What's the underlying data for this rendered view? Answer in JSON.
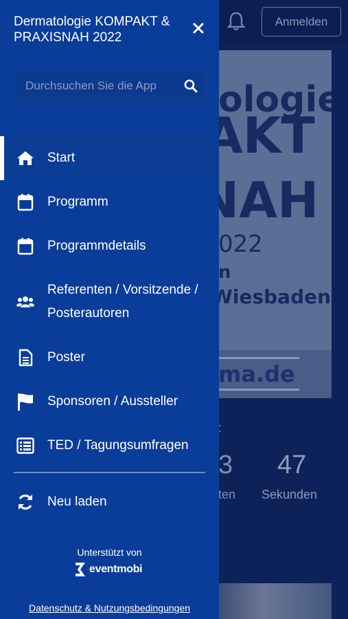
{
  "drawer": {
    "title": "Dermatologie KOMPAKT & PRAXISNAH 2022",
    "search_placeholder": "Durchsuchen Sie die App",
    "items": [
      {
        "label": "Start",
        "icon": "home-icon",
        "active": true
      },
      {
        "label": "Programm",
        "icon": "calendar-icon"
      },
      {
        "label": "Programmdetails",
        "icon": "calendar-icon"
      },
      {
        "label": "Referenten / Vorsitzende / Posterautoren",
        "icon": "users-icon"
      },
      {
        "label": "Poster",
        "icon": "document-icon"
      },
      {
        "label": "Sponsoren / Aussteller",
        "icon": "flag-icon"
      },
      {
        "label": "TED / Tagungsumfragen",
        "icon": "list-icon"
      }
    ],
    "reload_label": "Neu laden",
    "powered_by": "Unterstützt von",
    "logo_text": "eventmobi",
    "privacy_link": "Datenschutz & Nutzungsbedingungen"
  },
  "background": {
    "login_label": "Anmelden",
    "banner_lines": [
      "ologie",
      "AKT",
      "NAH",
      "022",
      "n",
      "Wiesbaden",
      "ma.de"
    ],
    "countdown_colon": ":",
    "count_a": "3",
    "count_b": "47",
    "label_a": "ten",
    "label_b": "Sekunden"
  },
  "colors": {
    "drawer_bg": "#0a3d99",
    "overlay_bg": "#0d2259",
    "text": "#ffffff"
  }
}
